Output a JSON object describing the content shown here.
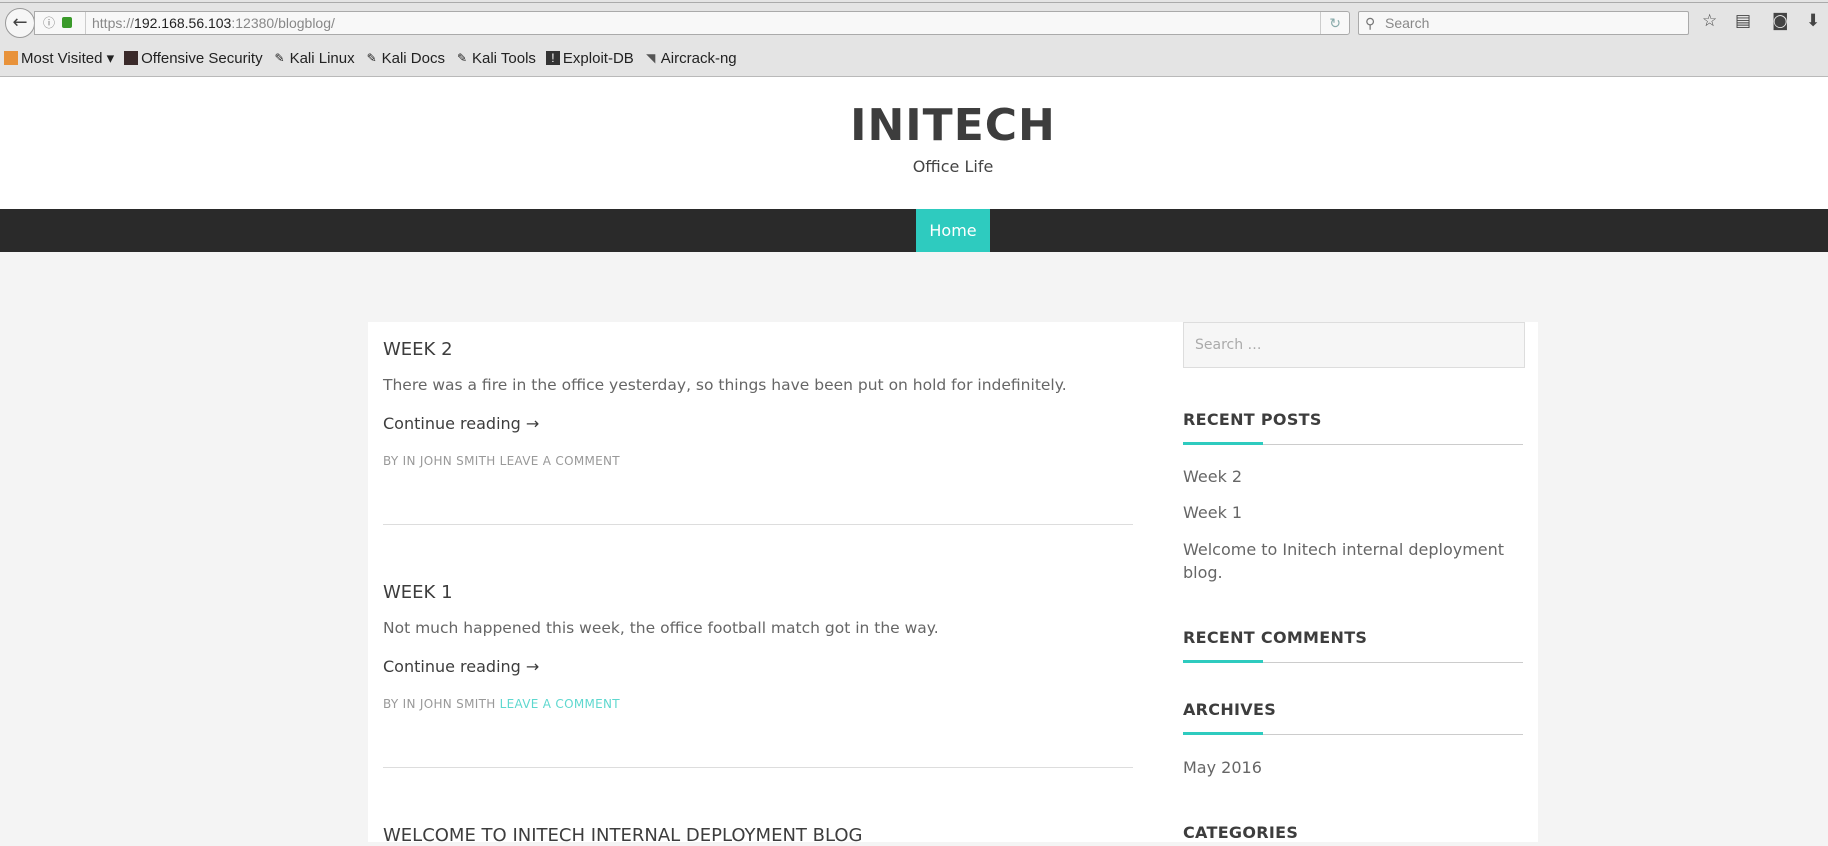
{
  "browser": {
    "url_prefix": "https://",
    "url_host": "192.168.56.103",
    "url_rest": ":12380/blogblog/",
    "search_placeholder": "Search",
    "bookmarks": [
      "Most Visited ▾",
      "Offensive Security",
      "Kali Linux",
      "Kali Docs",
      "Kali Tools",
      "Exploit-DB",
      "Aircrack-ng"
    ]
  },
  "site": {
    "title": "INITECH",
    "tagline": "Office Life"
  },
  "nav": {
    "home": "Home"
  },
  "posts": [
    {
      "title": "WEEK 2",
      "excerpt": "There was a fire in the office yesterday, so things have been put on hold for indefinitely.",
      "continue": "Continue reading →",
      "meta_by": "BY IN ",
      "meta_author": "JOHN SMITH",
      "meta_comment": "LEAVE A COMMENT"
    },
    {
      "title": "WEEK 1",
      "excerpt": "Not much happened this week, the office football match got in the way.",
      "continue": "Continue reading →",
      "meta_by": "BY IN ",
      "meta_author": "JOHN SMITH",
      "meta_comment": "LEAVE A COMMENT"
    },
    {
      "title": "WELCOME TO INITECH INTERNAL DEPLOYMENT BLOG"
    }
  ],
  "sidebar": {
    "search_placeholder": "Search …",
    "recent_posts_title": "RECENT POSTS",
    "recent_posts": [
      "Week 2",
      "Week 1",
      "Welcome to Initech internal deployment blog."
    ],
    "recent_comments_title": "RECENT COMMENTS",
    "archives_title": "ARCHIVES",
    "archives": [
      "May 2016"
    ],
    "categories_title": "CATEGORIES"
  },
  "colors": {
    "accent": "#2ecbbf",
    "nav_bg": "#2a2a2a"
  }
}
